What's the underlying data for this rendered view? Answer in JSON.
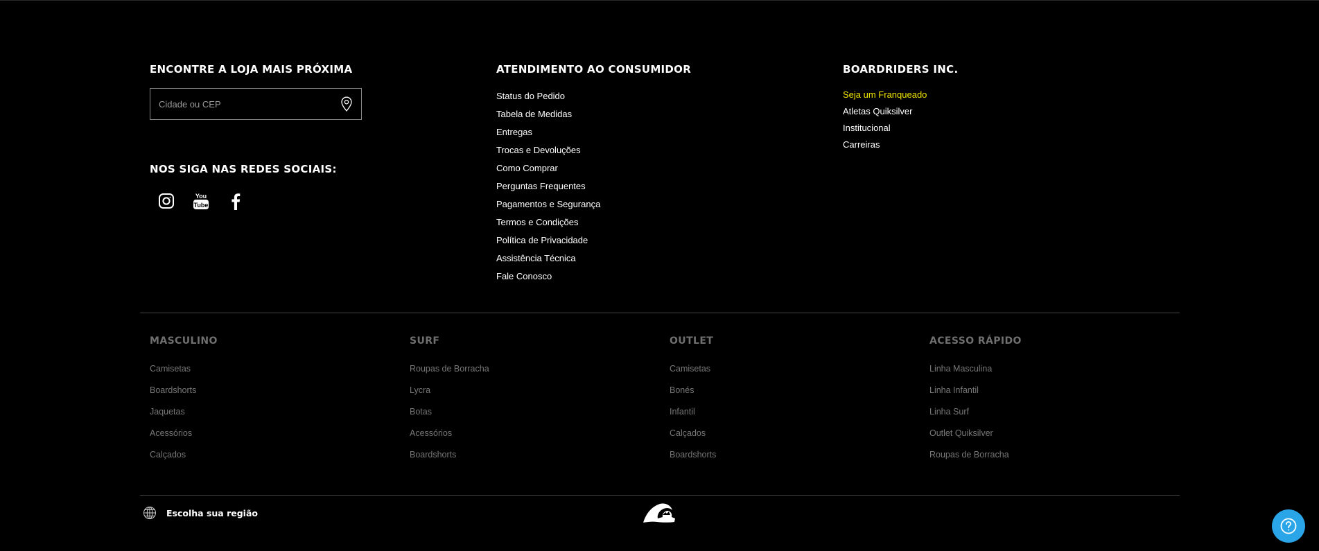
{
  "store_locator": {
    "heading": "ENCONTRE A LOJA MAIS PRÓXIMA",
    "placeholder": "Cidade ou CEP",
    "icon": "map-pin-icon"
  },
  "social": {
    "heading": "NOS SIGA NAS REDES SOCIAIS:",
    "items": [
      {
        "name": "Instagram",
        "icon": "instagram-icon"
      },
      {
        "name": "YouTube",
        "icon": "youtube-icon"
      },
      {
        "name": "Facebook",
        "icon": "facebook-icon"
      }
    ]
  },
  "customer_service": {
    "heading": "ATENDIMENTO AO CONSUMIDOR",
    "links": [
      "Status do Pedido",
      "Tabela de Medidas",
      "Entregas",
      "Trocas e Devoluções",
      "Como Comprar",
      "Perguntas Frequentes",
      "Pagamentos e Segurança",
      "Termos e Condições",
      "Política de Privacidade",
      "Assistência Técnica",
      "Fale Conosco"
    ]
  },
  "boardriders": {
    "heading": "BOARDRIDERS INC.",
    "highlight_color": "#f2e600",
    "links": [
      "Seja um Franqueado",
      "Atletas Quiksilver",
      "Institucional",
      "Carreiras"
    ]
  },
  "categories": {
    "masculino": {
      "title": "MASCULINO",
      "items": [
        "Camisetas",
        "Boardshorts",
        "Jaquetas",
        "Acessórios",
        "Calçados"
      ]
    },
    "surf": {
      "title": "SURF",
      "items": [
        "Roupas de Borracha",
        "Lycra",
        "Botas",
        "Acessórios",
        "Boardshorts"
      ]
    },
    "outlet": {
      "title": "OUTLET",
      "items": [
        "Camisetas",
        "Bonés",
        "Infantil",
        "Calçados",
        "Boardshorts"
      ]
    },
    "acesso_rapido": {
      "title": "ACESSO RÁPIDO",
      "items": [
        "Linha Masculina",
        "Linha Infantil",
        "Linha Surf",
        "Outlet Quiksilver",
        "Roupas de Borracha"
      ]
    }
  },
  "bottom_bar": {
    "region_label": "Escolha sua região",
    "region_icon": "globe-icon",
    "logo": "quiksilver-logo",
    "help_icon": "help-icon",
    "help_color": "#2aa6e8"
  }
}
